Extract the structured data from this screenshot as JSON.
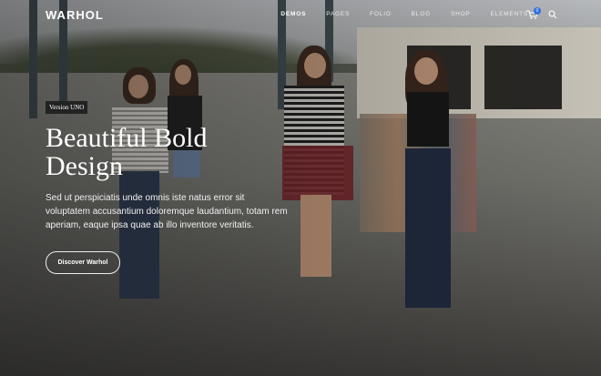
{
  "brand": {
    "logo": "WARHOL"
  },
  "nav": {
    "items": [
      {
        "label": "DEMOS",
        "active": true
      },
      {
        "label": "PAGES",
        "active": false
      },
      {
        "label": "FOLIO",
        "active": false
      },
      {
        "label": "BLOG",
        "active": false
      },
      {
        "label": "SHOP",
        "active": false
      },
      {
        "label": "ELEMENTS",
        "active": false
      }
    ],
    "cart_count": "0",
    "cart_icon": "cart-icon",
    "search_icon": "search-icon",
    "accent_color": "#2f6fe0"
  },
  "hero": {
    "badge": "Version UNO",
    "title_line1": "Beautiful Bold",
    "title_line2": "Design",
    "description": "Sed ut perspiciatis unde omnis iste natus error sit voluptatem accusantium doloremque laudantium, totam rem aperiam, eaque ipsa quae ab illo inventore veritatis.",
    "cta_label": "Discover Warhol"
  }
}
